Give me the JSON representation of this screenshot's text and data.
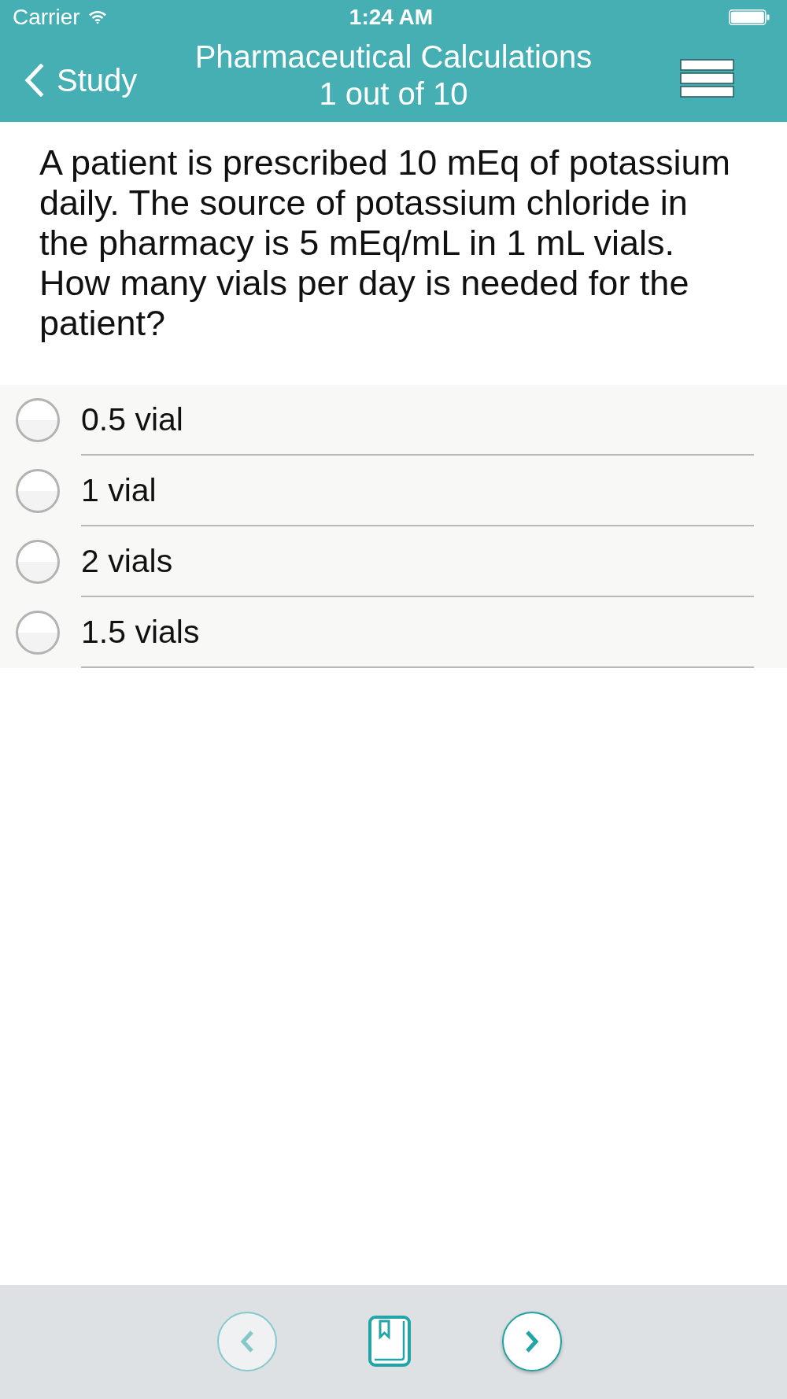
{
  "status_bar": {
    "carrier": "Carrier",
    "time": "1:24 AM"
  },
  "nav_bar": {
    "back_label": "Study",
    "title": "Pharmaceutical Calculations",
    "subtitle": "1 out of 10"
  },
  "question": {
    "text": "A patient is prescribed 10 mEq of potassium daily. The source of potassium chloride in the pharmacy is 5 mEq/mL in 1 mL vials. How many vials per day is needed for the patient?"
  },
  "options": [
    {
      "label": "0.5 vial",
      "selected": false
    },
    {
      "label": "1 vial",
      "selected": false
    },
    {
      "label": "2 vials",
      "selected": false
    },
    {
      "label": "1.5 vials",
      "selected": false
    }
  ],
  "toolbar": {
    "previous": {
      "disabled": true
    },
    "next": {
      "disabled": false
    }
  }
}
